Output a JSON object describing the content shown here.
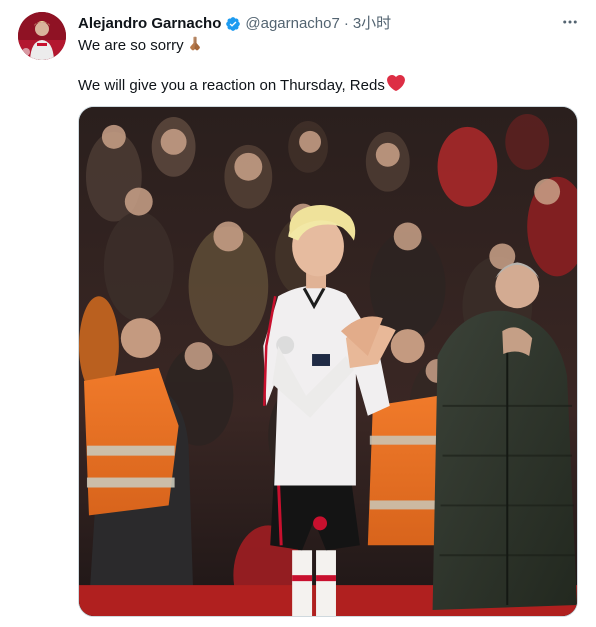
{
  "tweet": {
    "author": {
      "display_name": "Alejandro Garnacho",
      "handle": "@agarnacho7",
      "verified": true,
      "avatar_icon": "avatar-image"
    },
    "separator": "·",
    "timestamp": "3小时",
    "more_icon": "more-horizontal-icon",
    "text_lines": [
      "We are so sorry",
      "We will give you a reaction on Thursday, Reds"
    ],
    "emojis": {
      "line1": "folded-hands-icon",
      "line2": "red-heart-icon"
    },
    "media": {
      "type": "photo",
      "subject": "player-applauding-photo"
    }
  },
  "colors": {
    "text_primary": "#0f1419",
    "text_secondary": "#536471",
    "verified_blue": "#1d9bf0",
    "heart_red": "#f91880",
    "border": "#cfd9de"
  }
}
